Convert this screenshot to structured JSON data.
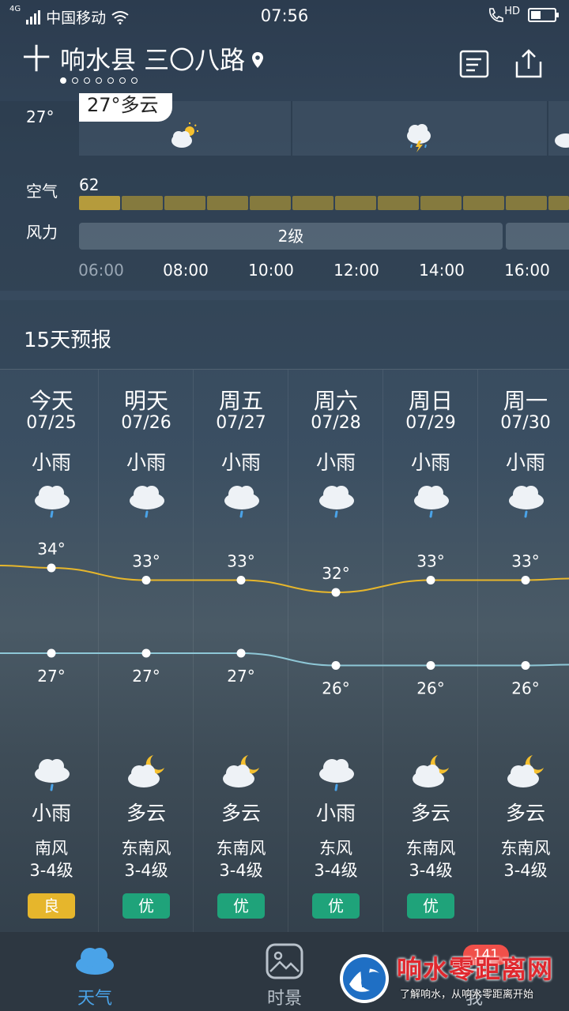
{
  "status_bar": {
    "network": "4G",
    "carrier": "中国移动",
    "time": "07:56",
    "hd": "HD"
  },
  "header": {
    "add_label": "十",
    "city": "响水县 三〇八路",
    "page_count": 7,
    "active_page": 0
  },
  "hourly": {
    "current_temp": "27°",
    "current_bubble": "27°多云",
    "air_label": "空气",
    "air_value": "62",
    "wind_label": "风力",
    "wind_value": "2级",
    "times": [
      "06:00",
      "08:00",
      "10:00",
      "12:00",
      "14:00",
      "16:00"
    ]
  },
  "forecast": {
    "title": "15天预报",
    "days": [
      {
        "day": "今天",
        "date": "07/25",
        "day_cond": "小雨",
        "day_icon": "rain-cloud-icon",
        "high": 34,
        "high_label": "34°",
        "low": 27,
        "low_label": "27°",
        "night_icon": "rain-cloud-icon",
        "night_cond": "小雨",
        "wind": "南风",
        "wind_level": "3-4级",
        "aqi": "良",
        "aqi_color": "#e6b62c"
      },
      {
        "day": "明天",
        "date": "07/26",
        "day_cond": "小雨",
        "day_icon": "rain-cloud-icon",
        "high": 33,
        "high_label": "33°",
        "low": 27,
        "low_label": "27°",
        "night_icon": "moon-cloud-icon",
        "night_cond": "多云",
        "wind": "东南风",
        "wind_level": "3-4级",
        "aqi": "优",
        "aqi_color": "#1fa37a"
      },
      {
        "day": "周五",
        "date": "07/27",
        "day_cond": "小雨",
        "day_icon": "rain-cloud-icon",
        "high": 33,
        "high_label": "33°",
        "low": 27,
        "low_label": "27°",
        "night_icon": "moon-cloud-icon",
        "night_cond": "多云",
        "wind": "东南风",
        "wind_level": "3-4级",
        "aqi": "优",
        "aqi_color": "#1fa37a"
      },
      {
        "day": "周六",
        "date": "07/28",
        "day_cond": "小雨",
        "day_icon": "rain-cloud-icon",
        "high": 32,
        "high_label": "32°",
        "low": 26,
        "low_label": "26°",
        "night_icon": "rain-cloud-icon",
        "night_cond": "小雨",
        "wind": "东风",
        "wind_level": "3-4级",
        "aqi": "优",
        "aqi_color": "#1fa37a"
      },
      {
        "day": "周日",
        "date": "07/29",
        "day_cond": "小雨",
        "day_icon": "rain-cloud-icon",
        "high": 33,
        "high_label": "33°",
        "low": 26,
        "low_label": "26°",
        "night_icon": "moon-cloud-icon",
        "night_cond": "多云",
        "wind": "东南风",
        "wind_level": "3-4级",
        "aqi": "优",
        "aqi_color": "#1fa37a"
      },
      {
        "day": "周一",
        "date": "07/30",
        "day_cond": "小雨",
        "day_icon": "rain-cloud-icon",
        "high": 33,
        "high_label": "33°",
        "low": 26,
        "low_label": "26°",
        "night_icon": "moon-cloud-icon",
        "night_cond": "多云",
        "wind": "东南风",
        "wind_level": "3-4级",
        "aqi": "",
        "aqi_color": ""
      }
    ],
    "high_line_color": "#e6b62c",
    "low_line_color": "#8ec7d6"
  },
  "bottom_nav": {
    "items": [
      {
        "label": "天气",
        "icon": "cloud-icon",
        "active": true
      },
      {
        "label": "时景",
        "icon": "photo-icon",
        "active": false
      },
      {
        "label": "我",
        "icon": "profile-icon",
        "active": false
      }
    ],
    "badge": "141",
    "active_color": "#4aa3e8"
  },
  "watermark": {
    "title": "响水零距离网",
    "slogan": "了解响水，从响水零距离开始"
  }
}
